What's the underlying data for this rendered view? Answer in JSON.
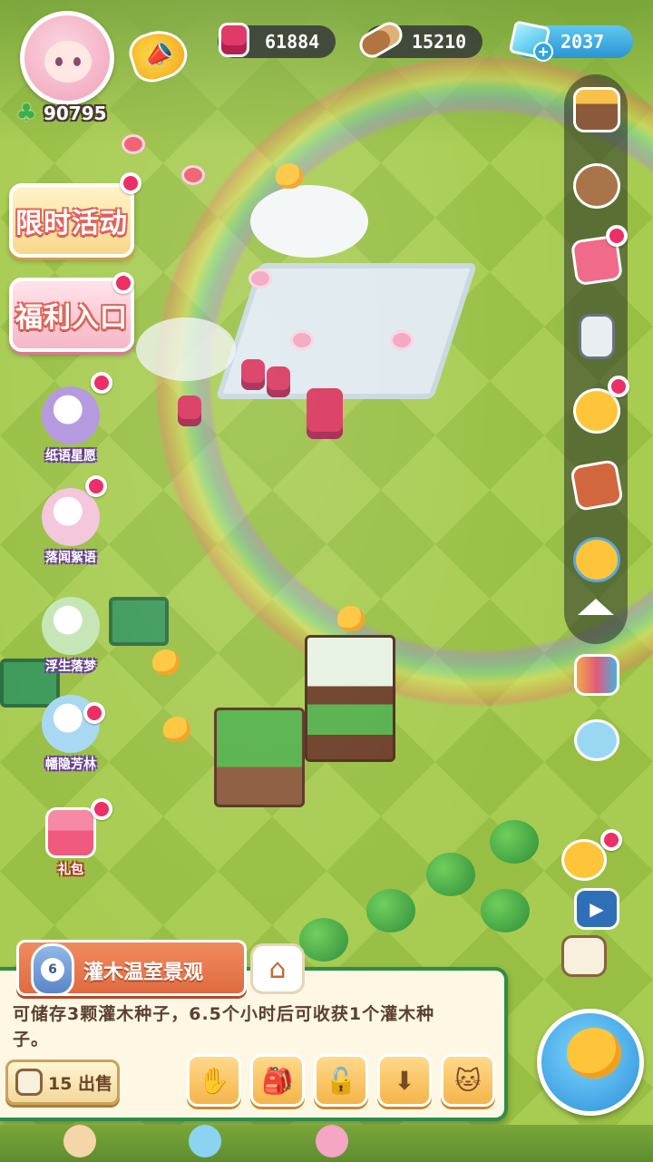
{
  "player": {
    "avatar_icon": "player-avatar",
    "clover_icon": "clover-icon",
    "clover_value": "90795"
  },
  "resources": [
    {
      "icon": "jam-jar-icon",
      "value": "61884"
    },
    {
      "icon": "wood-log-icon",
      "value": "15210"
    },
    {
      "icon": "gem-icon",
      "value": "2037",
      "has_plus": true
    }
  ],
  "left_menu": {
    "events": [
      {
        "label": "限时活动",
        "style": "gold",
        "has_badge": true
      },
      {
        "label": "福利入口",
        "style": "pink",
        "has_badge": true
      }
    ],
    "characters": [
      {
        "label": "纸语星愿",
        "has_badge": true,
        "color": "#b69ae0"
      },
      {
        "label": "落闻絮语",
        "has_badge": true,
        "color": "#f4c7dc"
      },
      {
        "label": "浮生落梦",
        "has_badge": false,
        "color": "#c6e6b8"
      },
      {
        "label": "幡隐芳林",
        "has_badge": true,
        "color": "#a9d9f2"
      }
    ],
    "gift": {
      "label": "礼包",
      "has_badge": true
    }
  },
  "right_toolbar": {
    "items": [
      {
        "icon": "shop-stall-icon",
        "has_badge": false
      },
      {
        "icon": "bear-friends-icon",
        "has_badge": false
      },
      {
        "icon": "notebook-icon",
        "has_badge": true
      },
      {
        "icon": "phone-device-icon",
        "has_badge": false
      },
      {
        "icon": "chick-bell-icon",
        "has_badge": true
      },
      {
        "icon": "book-icon",
        "has_badge": false
      },
      {
        "icon": "qa-chick-icon",
        "has_badge": false
      }
    ],
    "collapse_icon": "collapse-up-icon"
  },
  "floating_buttons": [
    {
      "icon": "camera-icon"
    },
    {
      "icon": "rotate-phone-icon"
    },
    {
      "icon": "chick-pair-icon"
    },
    {
      "icon": "video-icon"
    },
    {
      "icon": "notes-glasses-icon"
    }
  ],
  "info_panel": {
    "level": "6",
    "title": "灌木温室景观",
    "description": "可储存3颗灌木种子，6.5个小时后可收获1个灌木种子。",
    "sell_label": "15 出售",
    "actions": [
      {
        "icon": "move-hand-icon"
      },
      {
        "icon": "backpack-icon"
      },
      {
        "icon": "unlock-icon"
      },
      {
        "icon": "store-box-icon"
      },
      {
        "icon": "cat-face-icon"
      }
    ],
    "house_icon": "house-icon"
  },
  "globe_button": {
    "icon": "world-chick-icon"
  },
  "colors": {
    "badge_red": "#ec2f66",
    "panel_border": "#2e8c4a",
    "ribbon": "#e06a40"
  }
}
